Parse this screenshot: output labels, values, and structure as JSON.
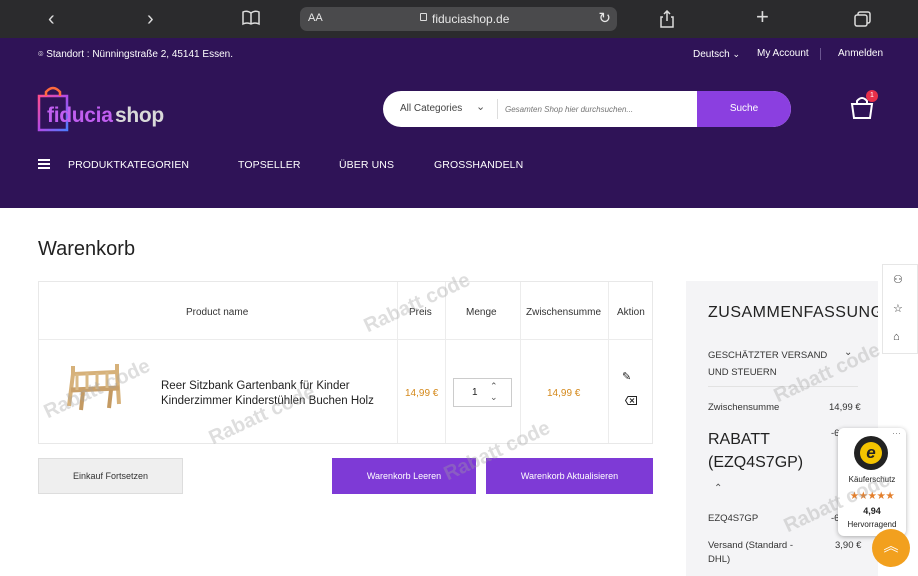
{
  "browser": {
    "text_size": "AA",
    "host": "fiduciashop.de"
  },
  "topbar": {
    "location": "Standort : Nünningstraße 2, 45141 Essen.",
    "language": "Deutsch",
    "account": "My Account",
    "login": "Anmelden"
  },
  "logo": {
    "part1": "fiducia",
    "part2": "shop"
  },
  "search": {
    "category": "All Categories",
    "placeholder": "Gesamten Shop hier durchsuchen...",
    "button": "Suche"
  },
  "cart": {
    "count": "1"
  },
  "menu": {
    "categories": "PRODUKTKATEGORIEN",
    "topseller": "TOPSELLER",
    "about": "ÜBER UNS",
    "wholesale": "GROSSHANDELN"
  },
  "page": {
    "title": "Warenkorb"
  },
  "table": {
    "headers": {
      "product": "Product name",
      "price": "Preis",
      "qty": "Menge",
      "subtotal": "Zwischensumme",
      "action": "Aktion"
    },
    "row": {
      "name": "Reer Sitzbank Gartenbank für Kinder Kinderzimmer Kinderstühlen Buchen Holz",
      "price": "14,99 €",
      "qty": "1",
      "subtotal": "14,99 €"
    }
  },
  "buttons": {
    "continue": "Einkauf Fortsetzen",
    "clear": "Warenkorb Leeren",
    "update": "Warenkorb Aktualisieren"
  },
  "summary": {
    "title": "ZUSAMMENFASSUNG",
    "shipping_label": "GESCHÄTZTER VERSAND UND STEUERN",
    "subtotal_label": "Zwischensumme",
    "subtotal_value": "14,99 €",
    "discount_label": "RABATT (EZQ4S7GP)",
    "discount_value": "-6",
    "code_label": "EZQ4S7GP",
    "code_value": "-6",
    "shipping_cost_label": "Versand (Standard - DHL)",
    "shipping_cost_value": "3,90 €"
  },
  "trusted": {
    "label": "Käuferschutz",
    "rating": "4,94",
    "verdict": "Hervorragend",
    "stars": "★★★★★",
    "seal_letter": "e"
  },
  "watermark": {
    "line1": "Rabatt",
    "line2": "code"
  },
  "colors": {
    "header_bg": "#2f1357",
    "accent": "#8b3fe0",
    "price": "#d4891b",
    "scroll_top": "#f2a01e"
  }
}
